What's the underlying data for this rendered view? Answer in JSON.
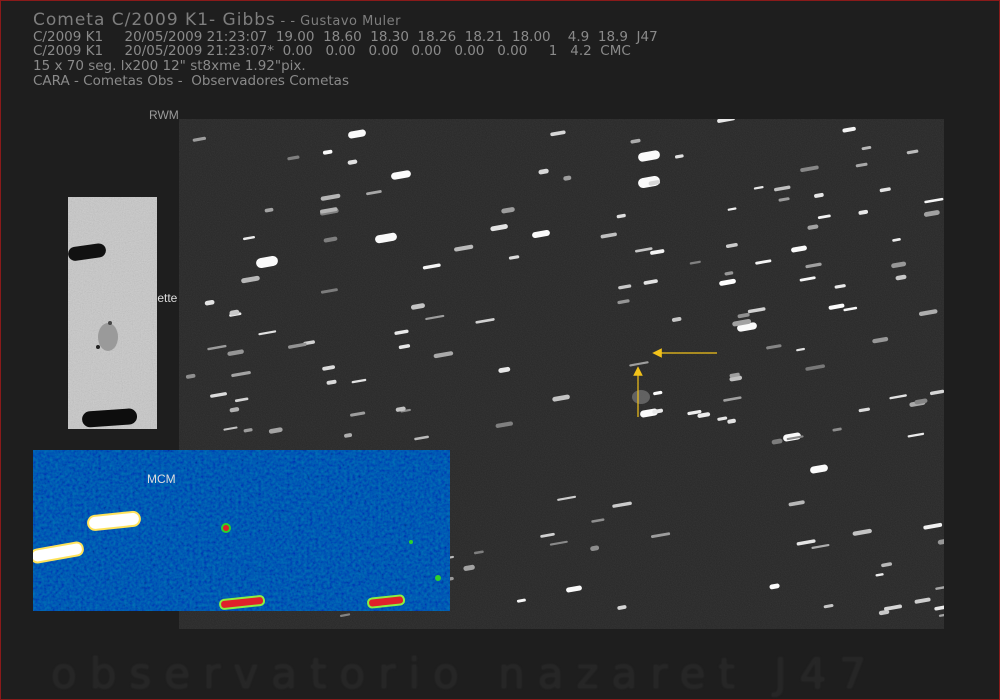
{
  "header": {
    "title": "Cometa C/2009 K1- Gibbs",
    "author": " - - Gustavo Muler",
    "line1": "C/2009 K1     20/05/2009 21:23:07  19.00  18.60  18.30  18.26  18.21  18.00    4.9  18.9  J47",
    "line2": "C/2009 K1     20/05/2009 21:23:07*  0.00   0.00   0.00   0.00   0.00   0.00     1   4.2  CMC",
    "line3": "15 x 70 seg. lx200 12\" st8xme 1.92\"pix.",
    "line4": "CARA - Cometas Obs -  Observadores Cometas"
  },
  "labels": {
    "rwm": "RWM",
    "palette": "Palette",
    "mcm": "MCM"
  },
  "footer": {
    "text": "observatorio nazaret J47"
  },
  "colors": {
    "background": "#1e1e1e",
    "arrow": "#f2c21a",
    "frame_border": "#8a1a1a"
  }
}
